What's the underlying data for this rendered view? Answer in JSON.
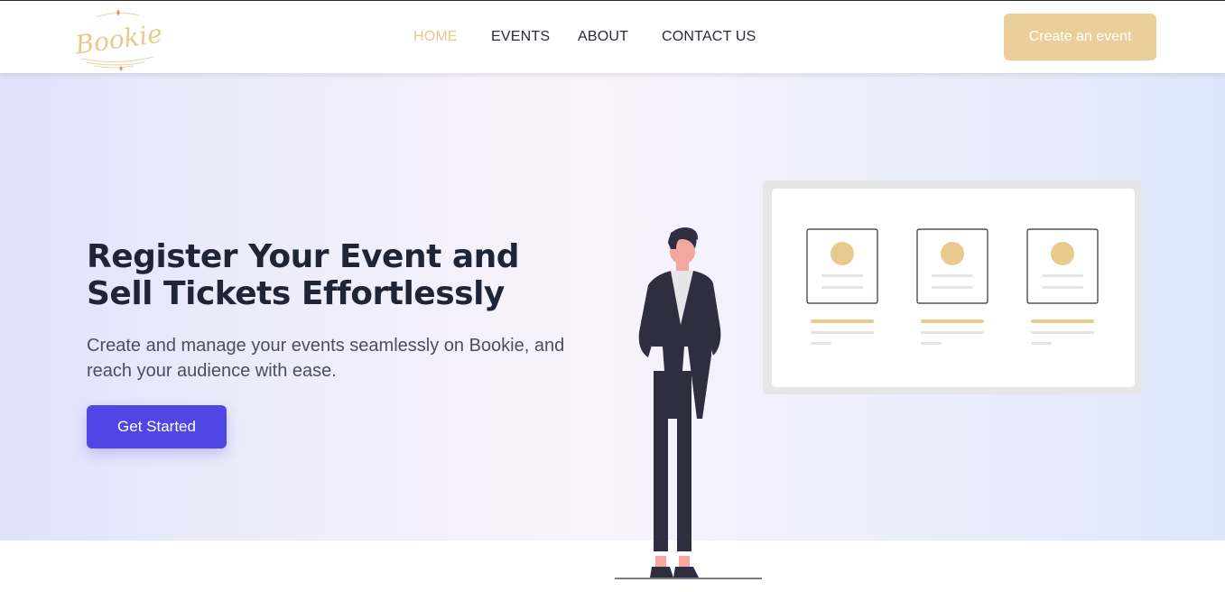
{
  "brand": {
    "logo_text": "Bookie",
    "logo_color": "#e8c98e"
  },
  "nav": {
    "items": [
      {
        "label": "HOME",
        "active": true
      },
      {
        "label": "EVENTS",
        "active": false
      },
      {
        "label": "ABOUT",
        "active": false
      },
      {
        "label": "CONTACT US",
        "active": false
      }
    ],
    "active_color": "#e8c98e"
  },
  "header": {
    "create_label": "Create an event",
    "create_color": "#ebcf9b"
  },
  "hero": {
    "title": "Register Your Event and Sell Tickets Effortlessly",
    "subtitle": "Create and manage your events seamlessly on Bookie, and reach your audience with ease.",
    "cta_label": "Get Started",
    "cta_color": "#4f46e5"
  },
  "illustration": {
    "name": "person-with-event-board-illustration",
    "card_count": 3
  }
}
